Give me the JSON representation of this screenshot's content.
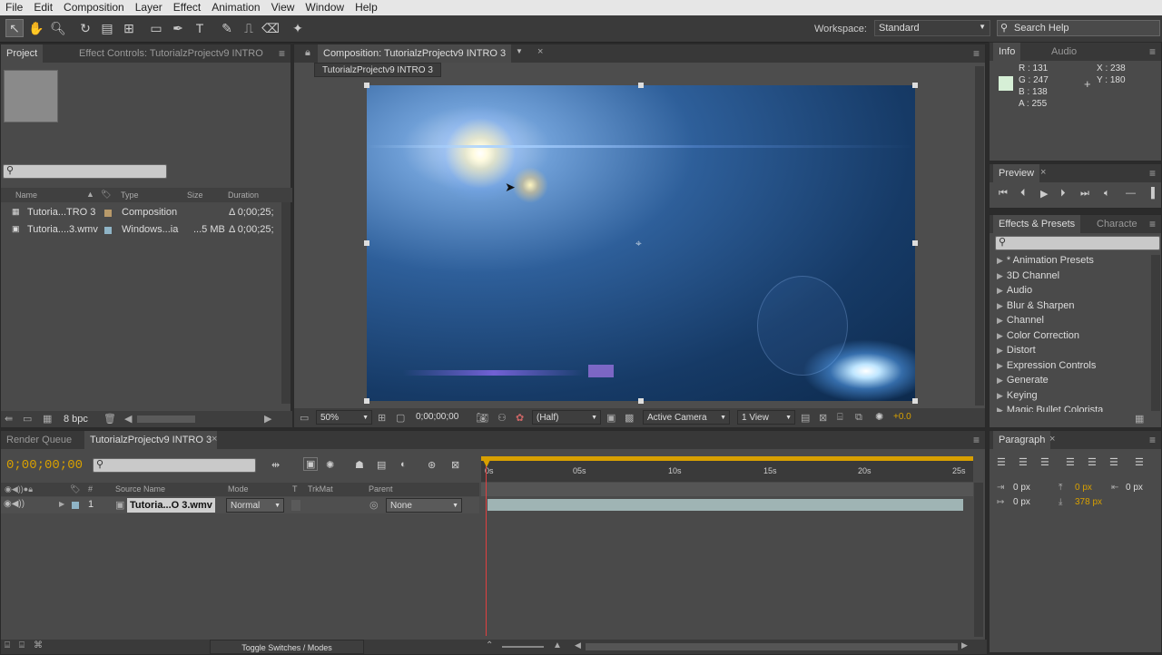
{
  "menu": [
    "File",
    "Edit",
    "Composition",
    "Layer",
    "Effect",
    "Animation",
    "View",
    "Window",
    "Help"
  ],
  "workspace": {
    "label": "Workspace:",
    "value": "Standard"
  },
  "search_help": {
    "placeholder": "Search Help"
  },
  "project_panel": {
    "tab_project": "Project",
    "tab_effect_controls": "Effect Controls: TutorialzProjectv9 INTRO",
    "columns": {
      "name": "Name",
      "type": "Type",
      "size": "Size",
      "duration": "Duration"
    },
    "items": [
      {
        "name": "Tutoria...TRO 3",
        "type": "Composition",
        "size": "",
        "duration": "Δ 0;00;25;",
        "color": "#b89a6a"
      },
      {
        "name": "Tutoria....3.wmv",
        "type": "Windows...ia",
        "size": "...5 MB",
        "duration": "Δ 0;00;25;",
        "color": "#8fb4c6"
      }
    ],
    "bpc": "8 bpc"
  },
  "composition_panel": {
    "tab": "Composition: TutorialzProjectv9 INTRO 3",
    "subtab": "TutorialzProjectv9 INTRO 3",
    "zoom": "50%",
    "timecode": "0;00;00;00",
    "resolution": "(Half)",
    "camera": "Active Camera",
    "views": "1 View",
    "exposure": "+0.0"
  },
  "info_panel": {
    "tab_info": "Info",
    "tab_audio": "Audio",
    "r": "R : 131",
    "g": "G : 247",
    "b": "B : 138",
    "a": "A : 255",
    "x": "X : 238",
    "y": "Y : 180",
    "swatch": "#d6efd6"
  },
  "preview_panel": {
    "tab": "Preview"
  },
  "effects_panel": {
    "tab": "Effects & Presets",
    "tab2": "Characte",
    "items": [
      "* Animation Presets",
      "3D Channel",
      "Audio",
      "Blur & Sharpen",
      "Channel",
      "Color Correction",
      "Distort",
      "Expression Controls",
      "Generate",
      "Keying",
      "Magic Bullet Colorista"
    ]
  },
  "timeline": {
    "tab_render": "Render Queue",
    "tab_comp": "TutorialzProjectv9 INTRO 3",
    "timecode": "0;00;00;00",
    "columns": {
      "source": "Source Name",
      "mode": "Mode",
      "t": "T",
      "trkmat": "TrkMat",
      "parent": "Parent"
    },
    "layer": {
      "num": "1",
      "name": "Tutoria...O 3.wmv",
      "mode": "Normal",
      "parent": "None"
    },
    "ruler": [
      "0s",
      "05s",
      "10s",
      "15s",
      "20s",
      "25s"
    ],
    "toggle": "Toggle Switches / Modes"
  },
  "paragraph_panel": {
    "tab": "Paragraph",
    "v1": "0 px",
    "v2": "0 px",
    "v3": "0 px",
    "v4": "0 px",
    "v5": "378 px"
  }
}
